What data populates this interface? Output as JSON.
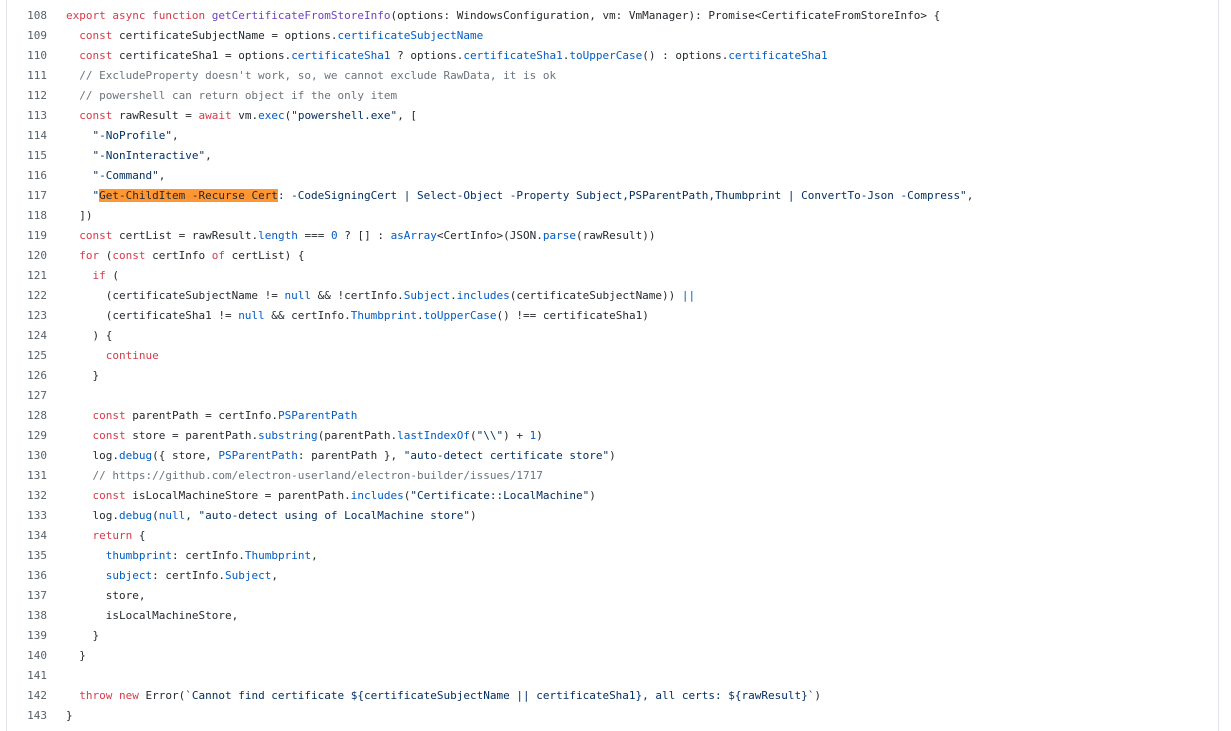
{
  "colors": {
    "keyword": "#d73a49",
    "function": "#6f42c1",
    "property": "#005cc5",
    "string": "#032f62",
    "comment": "#6a737d",
    "plain": "#24292e",
    "highlight": "#ff9632",
    "line_number": "#57606a"
  },
  "search": {
    "highlighted_text": "Get-ChildItem -Recurse Cert"
  },
  "lines": [
    {
      "n": "108",
      "tokens": [
        [
          "kw",
          "export async function "
        ],
        [
          "fn",
          "getCertificateFromStoreInfo"
        ],
        [
          "p",
          "(options: WindowsConfiguration, vm: VmManager): Promise<CertificateFromStoreInfo> {"
        ]
      ]
    },
    {
      "n": "109",
      "tokens": [
        [
          "p",
          "  "
        ],
        [
          "kw",
          "const"
        ],
        [
          "p",
          " certificateSubjectName = options."
        ],
        [
          "prop",
          "certificateSubjectName"
        ]
      ]
    },
    {
      "n": "110",
      "tokens": [
        [
          "p",
          "  "
        ],
        [
          "kw",
          "const"
        ],
        [
          "p",
          " certificateSha1 = options."
        ],
        [
          "prop",
          "certificateSha1"
        ],
        [
          "p",
          " ? options."
        ],
        [
          "prop",
          "certificateSha1"
        ],
        [
          "p",
          "."
        ],
        [
          "prop",
          "toUpperCase"
        ],
        [
          "p",
          "() : options."
        ],
        [
          "prop",
          "certificateSha1"
        ]
      ]
    },
    {
      "n": "111",
      "tokens": [
        [
          "p",
          "  "
        ],
        [
          "cmt",
          "// ExcludeProperty doesn't work, so, we cannot exclude RawData, it is ok"
        ]
      ]
    },
    {
      "n": "112",
      "tokens": [
        [
          "p",
          "  "
        ],
        [
          "cmt",
          "// powershell can return object if the only item"
        ]
      ]
    },
    {
      "n": "113",
      "tokens": [
        [
          "p",
          "  "
        ],
        [
          "kw",
          "const"
        ],
        [
          "p",
          " rawResult = "
        ],
        [
          "kw",
          "await"
        ],
        [
          "p",
          " vm."
        ],
        [
          "prop",
          "exec"
        ],
        [
          "p",
          "("
        ],
        [
          "str",
          "\"powershell.exe\""
        ],
        [
          "p",
          ", ["
        ]
      ]
    },
    {
      "n": "114",
      "tokens": [
        [
          "p",
          "    "
        ],
        [
          "str",
          "\"-NoProfile\""
        ],
        [
          "p",
          ","
        ]
      ]
    },
    {
      "n": "115",
      "tokens": [
        [
          "p",
          "    "
        ],
        [
          "str",
          "\"-NonInteractive\""
        ],
        [
          "p",
          ","
        ]
      ]
    },
    {
      "n": "116",
      "tokens": [
        [
          "p",
          "    "
        ],
        [
          "str",
          "\"-Command\""
        ],
        [
          "p",
          ","
        ]
      ]
    },
    {
      "n": "117",
      "tokens": [
        [
          "p",
          "    "
        ],
        [
          "str",
          "\""
        ],
        [
          "hl",
          "Get-ChildItem -Recurse Cert"
        ],
        [
          "str",
          ": -CodeSigningCert | Select-Object -Property Subject,PSParentPath,Thumbprint | ConvertTo-Json -Compress\""
        ],
        [
          "p",
          ","
        ]
      ]
    },
    {
      "n": "118",
      "tokens": [
        [
          "p",
          "  ])"
        ]
      ]
    },
    {
      "n": "119",
      "tokens": [
        [
          "p",
          "  "
        ],
        [
          "kw",
          "const"
        ],
        [
          "p",
          " certList = rawResult."
        ],
        [
          "prop",
          "length"
        ],
        [
          "p",
          " === "
        ],
        [
          "prop",
          "0"
        ],
        [
          "p",
          " ? [] : "
        ],
        [
          "prop",
          "asArray"
        ],
        [
          "p",
          "<CertInfo>(JSON."
        ],
        [
          "prop",
          "parse"
        ],
        [
          "p",
          "(rawResult))"
        ]
      ]
    },
    {
      "n": "120",
      "tokens": [
        [
          "p",
          "  "
        ],
        [
          "kw",
          "for"
        ],
        [
          "p",
          " ("
        ],
        [
          "kw",
          "const"
        ],
        [
          "p",
          " certInfo "
        ],
        [
          "kw",
          "of"
        ],
        [
          "p",
          " certList) {"
        ]
      ]
    },
    {
      "n": "121",
      "tokens": [
        [
          "p",
          "    "
        ],
        [
          "kw",
          "if"
        ],
        [
          "p",
          " ("
        ]
      ]
    },
    {
      "n": "122",
      "tokens": [
        [
          "p",
          "      (certificateSubjectName != "
        ],
        [
          "prop",
          "null"
        ],
        [
          "p",
          " && !certInfo."
        ],
        [
          "prop",
          "Subject"
        ],
        [
          "p",
          "."
        ],
        [
          "prop",
          "includes"
        ],
        [
          "p",
          "(certificateSubjectName)) "
        ],
        [
          "prop",
          "||"
        ]
      ]
    },
    {
      "n": "123",
      "tokens": [
        [
          "p",
          "      (certificateSha1 != "
        ],
        [
          "prop",
          "null"
        ],
        [
          "p",
          " && certInfo."
        ],
        [
          "prop",
          "Thumbprint"
        ],
        [
          "p",
          "."
        ],
        [
          "prop",
          "toUpperCase"
        ],
        [
          "p",
          "() !== certificateSha1)"
        ]
      ]
    },
    {
      "n": "124",
      "tokens": [
        [
          "p",
          "    ) {"
        ]
      ]
    },
    {
      "n": "125",
      "tokens": [
        [
          "p",
          "      "
        ],
        [
          "kw",
          "continue"
        ]
      ]
    },
    {
      "n": "126",
      "tokens": [
        [
          "p",
          "    }"
        ]
      ]
    },
    {
      "n": "127",
      "tokens": [
        [
          "p",
          ""
        ]
      ]
    },
    {
      "n": "128",
      "tokens": [
        [
          "p",
          "    "
        ],
        [
          "kw",
          "const"
        ],
        [
          "p",
          " parentPath = certInfo."
        ],
        [
          "prop",
          "PSParentPath"
        ]
      ]
    },
    {
      "n": "129",
      "tokens": [
        [
          "p",
          "    "
        ],
        [
          "kw",
          "const"
        ],
        [
          "p",
          " store = parentPath."
        ],
        [
          "prop",
          "substring"
        ],
        [
          "p",
          "(parentPath."
        ],
        [
          "prop",
          "lastIndexOf"
        ],
        [
          "p",
          "("
        ],
        [
          "str",
          "\"\\\\\""
        ],
        [
          "p",
          ") + "
        ],
        [
          "prop",
          "1"
        ],
        [
          "p",
          ")"
        ]
      ]
    },
    {
      "n": "130",
      "tokens": [
        [
          "p",
          "    log."
        ],
        [
          "prop",
          "debug"
        ],
        [
          "p",
          "({ store, "
        ],
        [
          "prop",
          "PSParentPath"
        ],
        [
          "p",
          ": parentPath }, "
        ],
        [
          "str",
          "\"auto-detect certificate store\""
        ],
        [
          "p",
          ")"
        ]
      ]
    },
    {
      "n": "131",
      "tokens": [
        [
          "p",
          "    "
        ],
        [
          "cmt",
          "// https://github.com/electron-userland/electron-builder/issues/1717"
        ]
      ]
    },
    {
      "n": "132",
      "tokens": [
        [
          "p",
          "    "
        ],
        [
          "kw",
          "const"
        ],
        [
          "p",
          " isLocalMachineStore = parentPath."
        ],
        [
          "prop",
          "includes"
        ],
        [
          "p",
          "("
        ],
        [
          "str",
          "\"Certificate::LocalMachine\""
        ],
        [
          "p",
          ")"
        ]
      ]
    },
    {
      "n": "133",
      "tokens": [
        [
          "p",
          "    log."
        ],
        [
          "prop",
          "debug"
        ],
        [
          "p",
          "("
        ],
        [
          "prop",
          "null"
        ],
        [
          "p",
          ", "
        ],
        [
          "str",
          "\"auto-detect using of LocalMachine store\""
        ],
        [
          "p",
          ")"
        ]
      ]
    },
    {
      "n": "134",
      "tokens": [
        [
          "p",
          "    "
        ],
        [
          "kw",
          "return"
        ],
        [
          "p",
          " {"
        ]
      ]
    },
    {
      "n": "135",
      "tokens": [
        [
          "p",
          "      "
        ],
        [
          "prop",
          "thumbprint"
        ],
        [
          "p",
          ": certInfo."
        ],
        [
          "prop",
          "Thumbprint"
        ],
        [
          "p",
          ","
        ]
      ]
    },
    {
      "n": "136",
      "tokens": [
        [
          "p",
          "      "
        ],
        [
          "prop",
          "subject"
        ],
        [
          "p",
          ": certInfo."
        ],
        [
          "prop",
          "Subject"
        ],
        [
          "p",
          ","
        ]
      ]
    },
    {
      "n": "137",
      "tokens": [
        [
          "p",
          "      store,"
        ]
      ]
    },
    {
      "n": "138",
      "tokens": [
        [
          "p",
          "      isLocalMachineStore,"
        ]
      ]
    },
    {
      "n": "139",
      "tokens": [
        [
          "p",
          "    }"
        ]
      ]
    },
    {
      "n": "140",
      "tokens": [
        [
          "p",
          "  }"
        ]
      ]
    },
    {
      "n": "141",
      "tokens": [
        [
          "p",
          ""
        ]
      ]
    },
    {
      "n": "142",
      "tokens": [
        [
          "p",
          "  "
        ],
        [
          "kw",
          "throw new"
        ],
        [
          "p",
          " Error("
        ],
        [
          "str",
          "`Cannot find certificate ${certificateSubjectName || certificateSha1}, all certs: ${rawResult}`"
        ],
        [
          "p",
          ")"
        ]
      ]
    },
    {
      "n": "143",
      "tokens": [
        [
          "p",
          "}"
        ]
      ]
    }
  ]
}
